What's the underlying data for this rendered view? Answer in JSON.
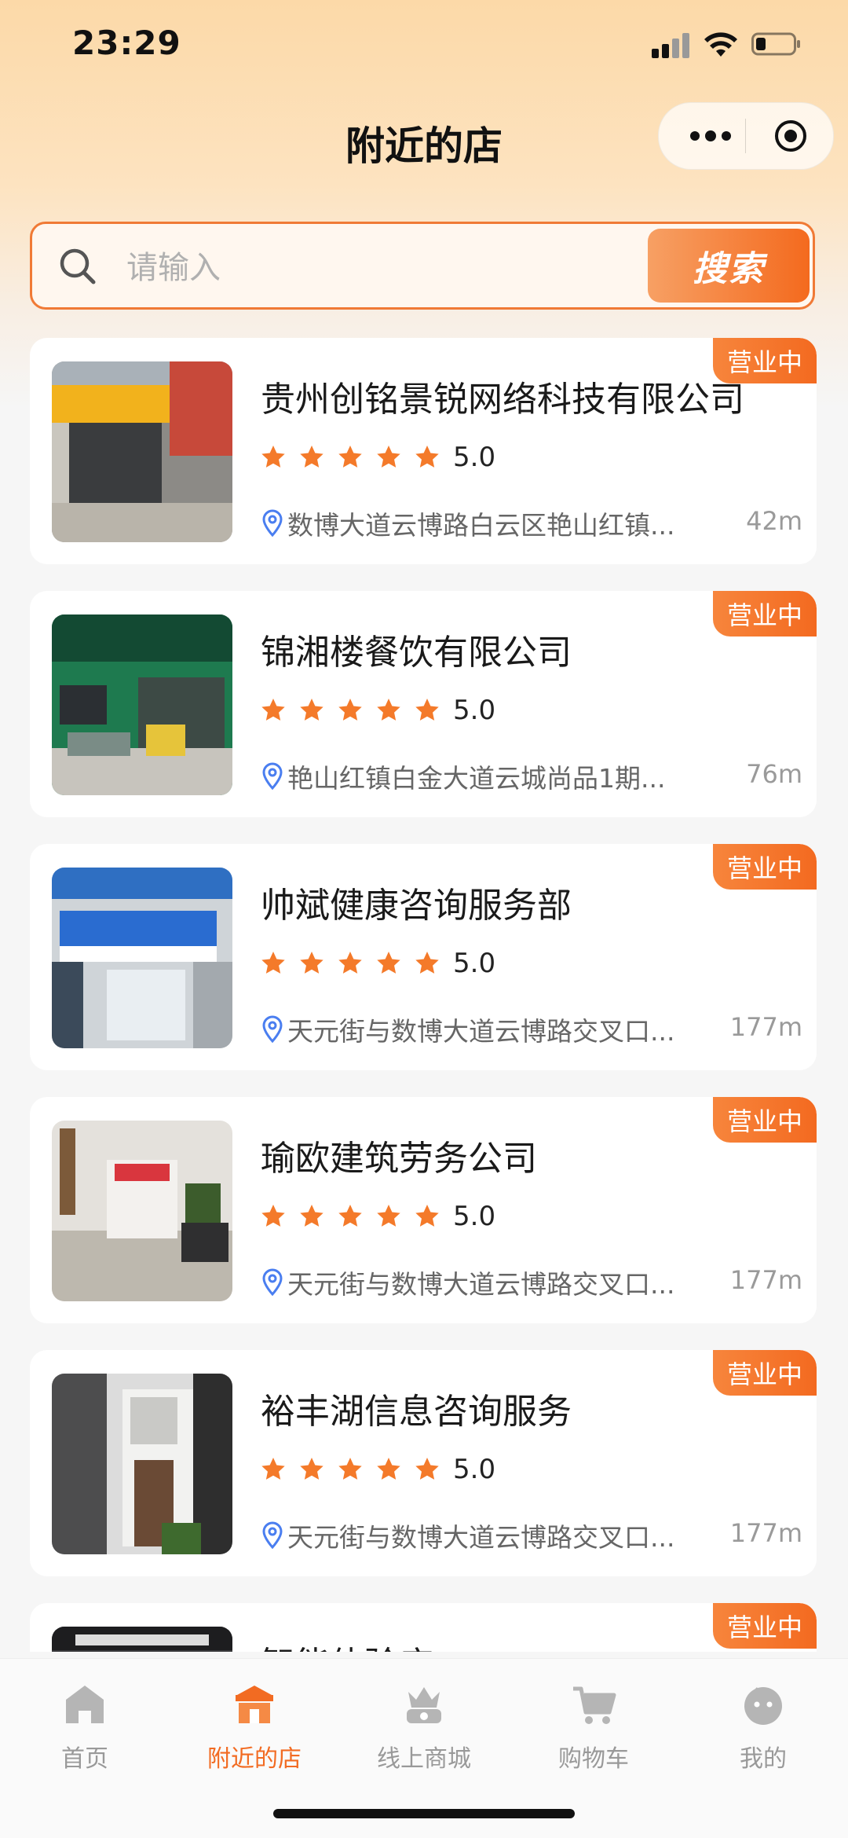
{
  "status_bar": {
    "time": "23:29"
  },
  "header": {
    "title": "附近的店"
  },
  "search": {
    "placeholder": "请输入",
    "value": "",
    "button_label": "搜索"
  },
  "stores": [
    {
      "name": "贵州创铭景锐网络科技有限公司",
      "rating": "5.0",
      "stars": 5,
      "address": "数博大道云博路白云区艳山红镇...",
      "distance": "42m",
      "status": "营业中"
    },
    {
      "name": "锦湘楼餐饮有限公司",
      "rating": "5.0",
      "stars": 5,
      "address": "艳山红镇白金大道云城尚品1期...",
      "distance": "76m",
      "status": "营业中"
    },
    {
      "name": "帅斌健康咨询服务部",
      "rating": "5.0",
      "stars": 5,
      "address": "天元街与数博大道云博路交叉口...",
      "distance": "177m",
      "status": "营业中"
    },
    {
      "name": "瑜欧建筑劳务公司",
      "rating": "5.0",
      "stars": 5,
      "address": "天元街与数博大道云博路交叉口...",
      "distance": "177m",
      "status": "营业中"
    },
    {
      "name": "裕丰湖信息咨询服务",
      "rating": "5.0",
      "stars": 5,
      "address": "天元街与数博大道云博路交叉口...",
      "distance": "177m",
      "status": "营业中"
    },
    {
      "name": "智能体验店",
      "rating": "",
      "stars": 0,
      "address": "",
      "distance": "",
      "status": "营业中"
    }
  ],
  "tab_bar": {
    "items": [
      {
        "label": "首页",
        "icon": "home-icon"
      },
      {
        "label": "附近的店",
        "icon": "store-icon",
        "active": true
      },
      {
        "label": "线上商城",
        "icon": "crown-basket-icon"
      },
      {
        "label": "购物车",
        "icon": "cart-icon"
      },
      {
        "label": "我的",
        "icon": "profile-icon"
      }
    ]
  },
  "colors": {
    "accent": "#f26b22",
    "star": "#f47a2a",
    "location_icon": "#4a7ef0"
  }
}
